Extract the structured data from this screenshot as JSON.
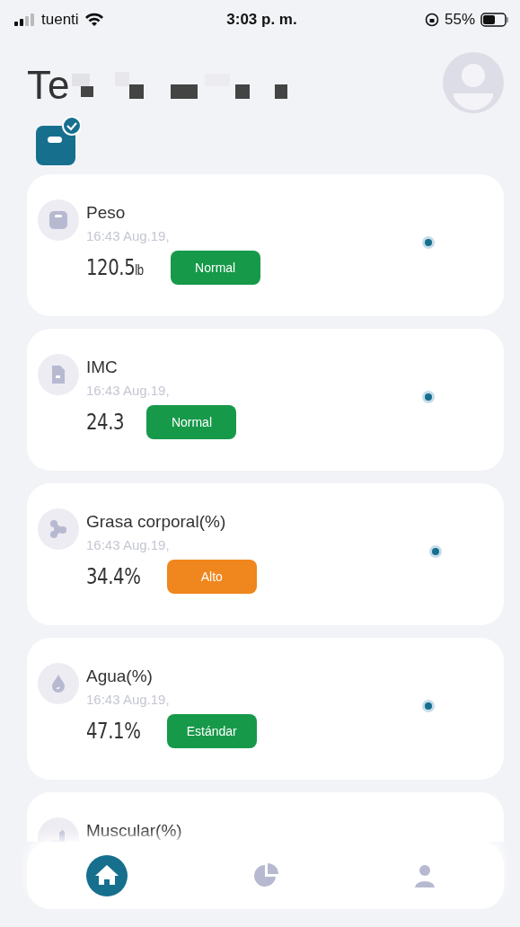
{
  "status_bar": {
    "carrier": "tuenti",
    "time": "3:03 p. m.",
    "battery": "55%"
  },
  "header": {
    "title": "Te",
    "device_connected": true
  },
  "metrics": [
    {
      "kind": "scale",
      "name": "Peso",
      "time": "16:43 Aug.19,",
      "value": "120.5",
      "unit": "lb",
      "badge": {
        "label": "Normal",
        "color": "#17994a"
      }
    },
    {
      "kind": "bmi",
      "name": "IMC",
      "time": "16:43 Aug.19,",
      "value": "24.3",
      "badge": {
        "label": "Normal",
        "color": "#17994a"
      }
    },
    {
      "kind": "fat",
      "name": "Grasa corporal(%)",
      "time": "16:43 Aug.19,",
      "value": "34.4%",
      "badge": {
        "label": "Alto",
        "color": "#f0861e"
      }
    },
    {
      "kind": "water",
      "name": "Agua(%)",
      "time": "16:43 Aug.19,",
      "value": "47.1%",
      "badge": {
        "label": "Estándar",
        "color": "#17994a"
      }
    },
    {
      "kind": "muscle",
      "name": "Muscular(%)"
    }
  ],
  "nav": [
    {
      "kind": "home",
      "selected": true
    },
    {
      "kind": "chart",
      "selected": false
    },
    {
      "kind": "person",
      "selected": false
    }
  ]
}
